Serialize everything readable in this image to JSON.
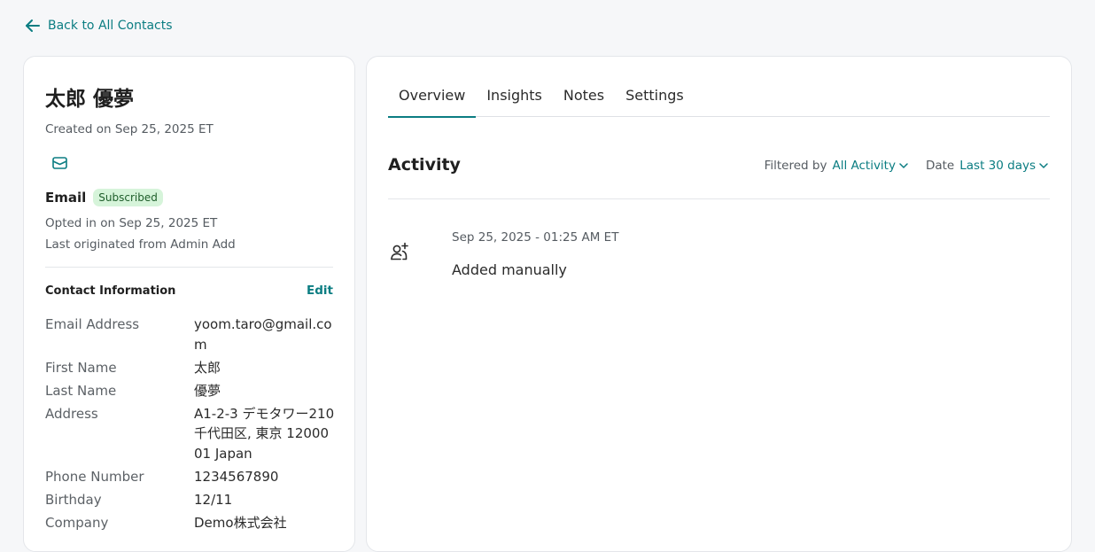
{
  "back_link": {
    "label": "Back to All Contacts"
  },
  "contact": {
    "name": "太郎 優夢",
    "created_on": "Created on Sep 25, 2025 ET",
    "email_section": {
      "label": "Email",
      "status_badge": "Subscribed",
      "opted_in": "Opted in on Sep 25, 2025 ET",
      "last_originated": "Last originated from Admin Add"
    },
    "contact_information": {
      "title": "Contact Information",
      "edit_label": "Edit",
      "fields": [
        {
          "label": "Email Address",
          "value": "yoom.taro@gmail.com"
        },
        {
          "label": "First Name",
          "value": "太郎"
        },
        {
          "label": "Last Name",
          "value": "優夢"
        },
        {
          "label": "Address",
          "value": "A1-2-3 デモタワー210 千代田区, 東京 1200001 Japan"
        },
        {
          "label": "Phone Number",
          "value": "1234567890"
        },
        {
          "label": "Birthday",
          "value": "12/11"
        },
        {
          "label": "Company",
          "value": "Demo株式会社"
        }
      ]
    }
  },
  "tabs": [
    {
      "label": "Overview",
      "active": true
    },
    {
      "label": "Insights",
      "active": false
    },
    {
      "label": "Notes",
      "active": false
    },
    {
      "label": "Settings",
      "active": false
    }
  ],
  "activity": {
    "title": "Activity",
    "filter_label": "Filtered by",
    "filter_value": "All Activity",
    "date_label": "Date",
    "date_value": "Last 30 days",
    "items": [
      {
        "timestamp": "Sep 25, 2025 - 01:25 AM ET",
        "description": "Added manually",
        "icon": "user-add-icon"
      }
    ]
  },
  "colors": {
    "accent": "#0b7d82",
    "background": "#f6f7f9",
    "card": "#ffffff",
    "badge_bg": "#d6f4da"
  }
}
